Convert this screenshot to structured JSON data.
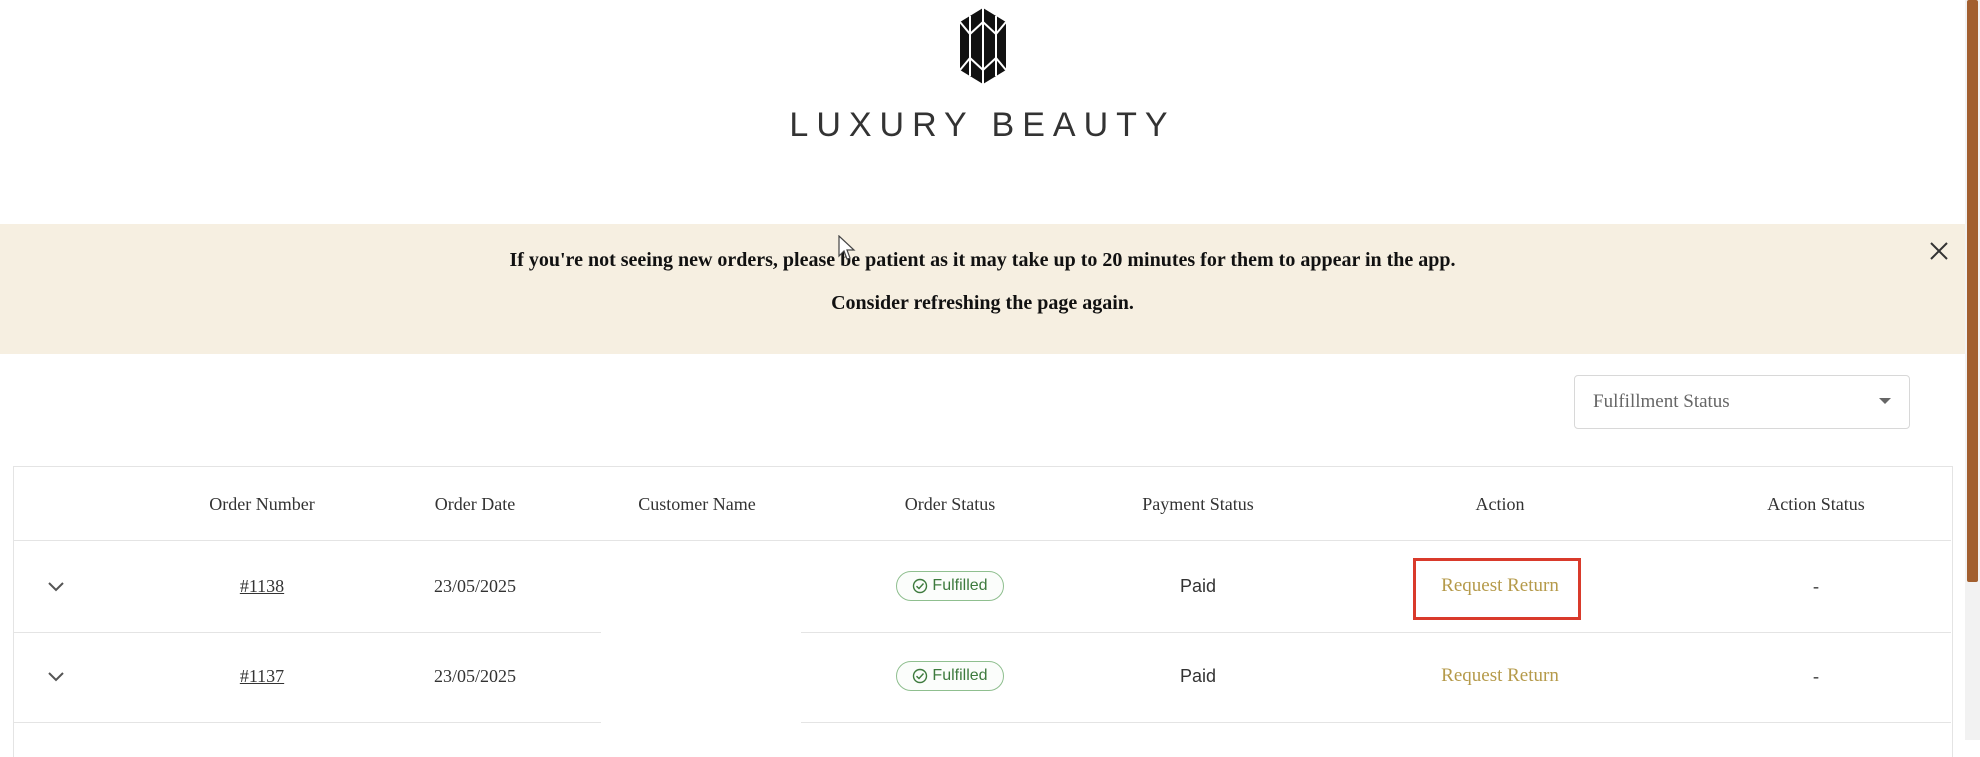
{
  "brand": {
    "name": "LUXURY BEAUTY",
    "logo_icon": "gem-icon"
  },
  "banner": {
    "line1": "If you're not seeing new orders, please be patient as it may take up to 20 minutes for them to appear in the app.",
    "line2": "Consider refreshing the page again.",
    "close_icon": "close-icon",
    "background": "#f6efe1"
  },
  "filter": {
    "label": "Fulfillment Status"
  },
  "table": {
    "headers": [
      "Order Number",
      "Order Date",
      "Customer Name",
      "Order Status",
      "Payment Status",
      "Action",
      "Action Status"
    ],
    "rows": [
      {
        "order_number": "#1138",
        "order_date": "23/05/2025",
        "customer_name": "",
        "order_status": "Fulfilled",
        "payment_status": "Paid",
        "action": "Request Return",
        "action_status": "-"
      },
      {
        "order_number": "#1137",
        "order_date": "23/05/2025",
        "customer_name": "",
        "order_status": "Fulfilled",
        "payment_status": "Paid",
        "action": "Request Return",
        "action_status": "-"
      }
    ]
  },
  "colors": {
    "accent_link": "#b59a4a",
    "status_green": "#3d7a3d",
    "highlight": "#d93a2b",
    "scrollbar": "#a25f2f"
  }
}
